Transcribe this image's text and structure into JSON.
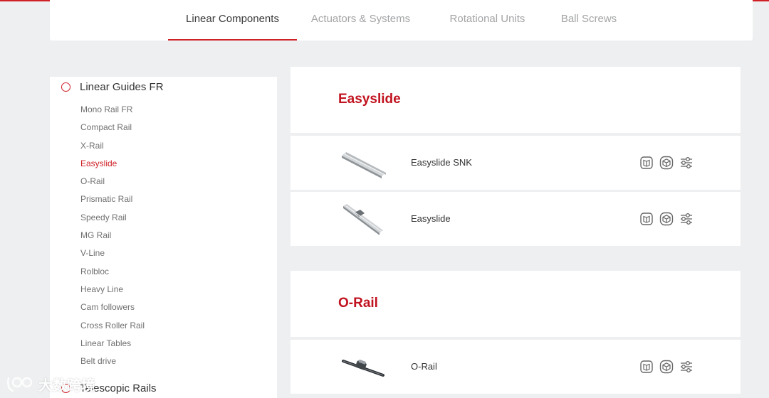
{
  "tabs": [
    {
      "label": "Linear Components",
      "active": true
    },
    {
      "label": "Actuators & Systems",
      "active": false
    },
    {
      "label": "Rotational Units",
      "active": false
    },
    {
      "label": "Ball Screws",
      "active": false
    }
  ],
  "sidebar": {
    "categories": [
      {
        "label": "Linear Guides FR",
        "items": [
          "Mono Rail FR",
          "Compact Rail",
          "X-Rail",
          "Easyslide",
          "O-Rail",
          "Prismatic Rail",
          "Speedy Rail",
          "MG Rail",
          "V-Line",
          "Rolbloc",
          "Heavy Line",
          "Cam followers",
          "Cross Roller Rail",
          "Linear Tables",
          "Belt drive"
        ],
        "active_item": "Easyslide"
      },
      {
        "label": "Telescopic Rails",
        "items": []
      }
    ]
  },
  "sections": [
    {
      "title": "Easyslide",
      "products": [
        {
          "name": "Easyslide SNK"
        },
        {
          "name": "Easyslide"
        }
      ]
    },
    {
      "title": "O-Rail",
      "products": [
        {
          "name": "O-Rail"
        }
      ]
    }
  ],
  "product_actions": [
    "catalog-icon",
    "3d-model-icon",
    "configurator-icon"
  ],
  "watermark": {
    "text": "大数跨境"
  },
  "colors": {
    "accent": "#cf2026",
    "section_title": "#c1121f",
    "background": "#eeeff0",
    "tab_inactive": "#a2a4a6",
    "sub_item": "#707070"
  }
}
